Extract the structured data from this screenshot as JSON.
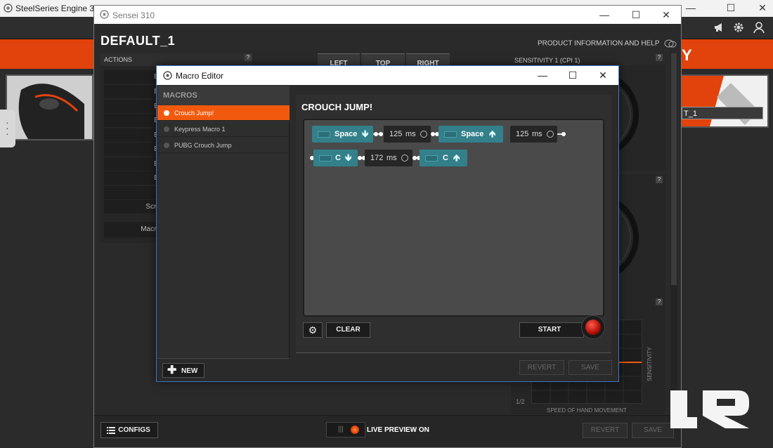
{
  "engine": {
    "title": "SteelSeries Engine 3",
    "controls": {
      "minimize": "—",
      "maximize": "☐",
      "close": "✕"
    },
    "orange_banner_right": "Y",
    "thumb_label": "T_1"
  },
  "sensei": {
    "title": "Sensei 310",
    "controls": {
      "minimize": "—",
      "maximize": "☐",
      "close": "✕"
    },
    "profile_title": "DEFAULT_1",
    "product_info": "PRODUCT INFORMATION AND HELP",
    "actions": {
      "header": "ACTIONS",
      "help": "?",
      "rows": [
        "Button",
        "Button",
        "Button",
        "Button",
        "Button",
        "Button",
        "Button",
        "Button",
        "Scroll",
        "Scroll Do",
        "Macro Edit"
      ]
    },
    "tabs": [
      "LEFT",
      "TOP",
      "RIGHT"
    ],
    "sensitivity_header": "SENSITIVITY 1 (CPI 1)",
    "sensitivity_vertical": "SENSITIVITY",
    "speed_label": "SPEED OF HAND MOVEMENT",
    "speed_fraction": "1/2",
    "bottom": {
      "configs": "CONFIGS",
      "live_preview": "LIVE PREVIEW ON",
      "revert": "REVERT",
      "save": "SAVE"
    }
  },
  "macro_editor": {
    "title": "Macro Editor",
    "controls": {
      "minimize": "—",
      "maximize": "☐",
      "close": "✕"
    },
    "macros_header": "MACROS",
    "macros": [
      {
        "label": "Crouch Jump!",
        "active": true
      },
      {
        "label": "Keypress Macro 1",
        "active": false
      },
      {
        "label": "PUBG Crouch Jump",
        "active": false
      }
    ],
    "new_button": "NEW",
    "editor_title": "CROUCH JUMP!",
    "sequence_row1": [
      {
        "type": "key",
        "key": "Space",
        "direction": "down",
        "arrow": "🡻"
      },
      {
        "type": "delay",
        "value": "125",
        "unit": "ms"
      },
      {
        "type": "key",
        "key": "Space",
        "direction": "up",
        "arrow": "🡹"
      },
      {
        "type": "delay",
        "value": "125",
        "unit": "ms"
      }
    ],
    "sequence_row2": [
      {
        "type": "key",
        "key": "C",
        "direction": "down",
        "arrow": "🡻"
      },
      {
        "type": "delay",
        "value": "172",
        "unit": "ms"
      },
      {
        "type": "key",
        "key": "C",
        "direction": "up",
        "arrow": "🡹"
      }
    ],
    "clear_button": "CLEAR",
    "start_button": "START",
    "revert_button": "REVERT",
    "save_button": "SAVE"
  },
  "colors": {
    "accent": "#f15a0e",
    "key_block": "#33808a",
    "record": "#d01a10"
  }
}
